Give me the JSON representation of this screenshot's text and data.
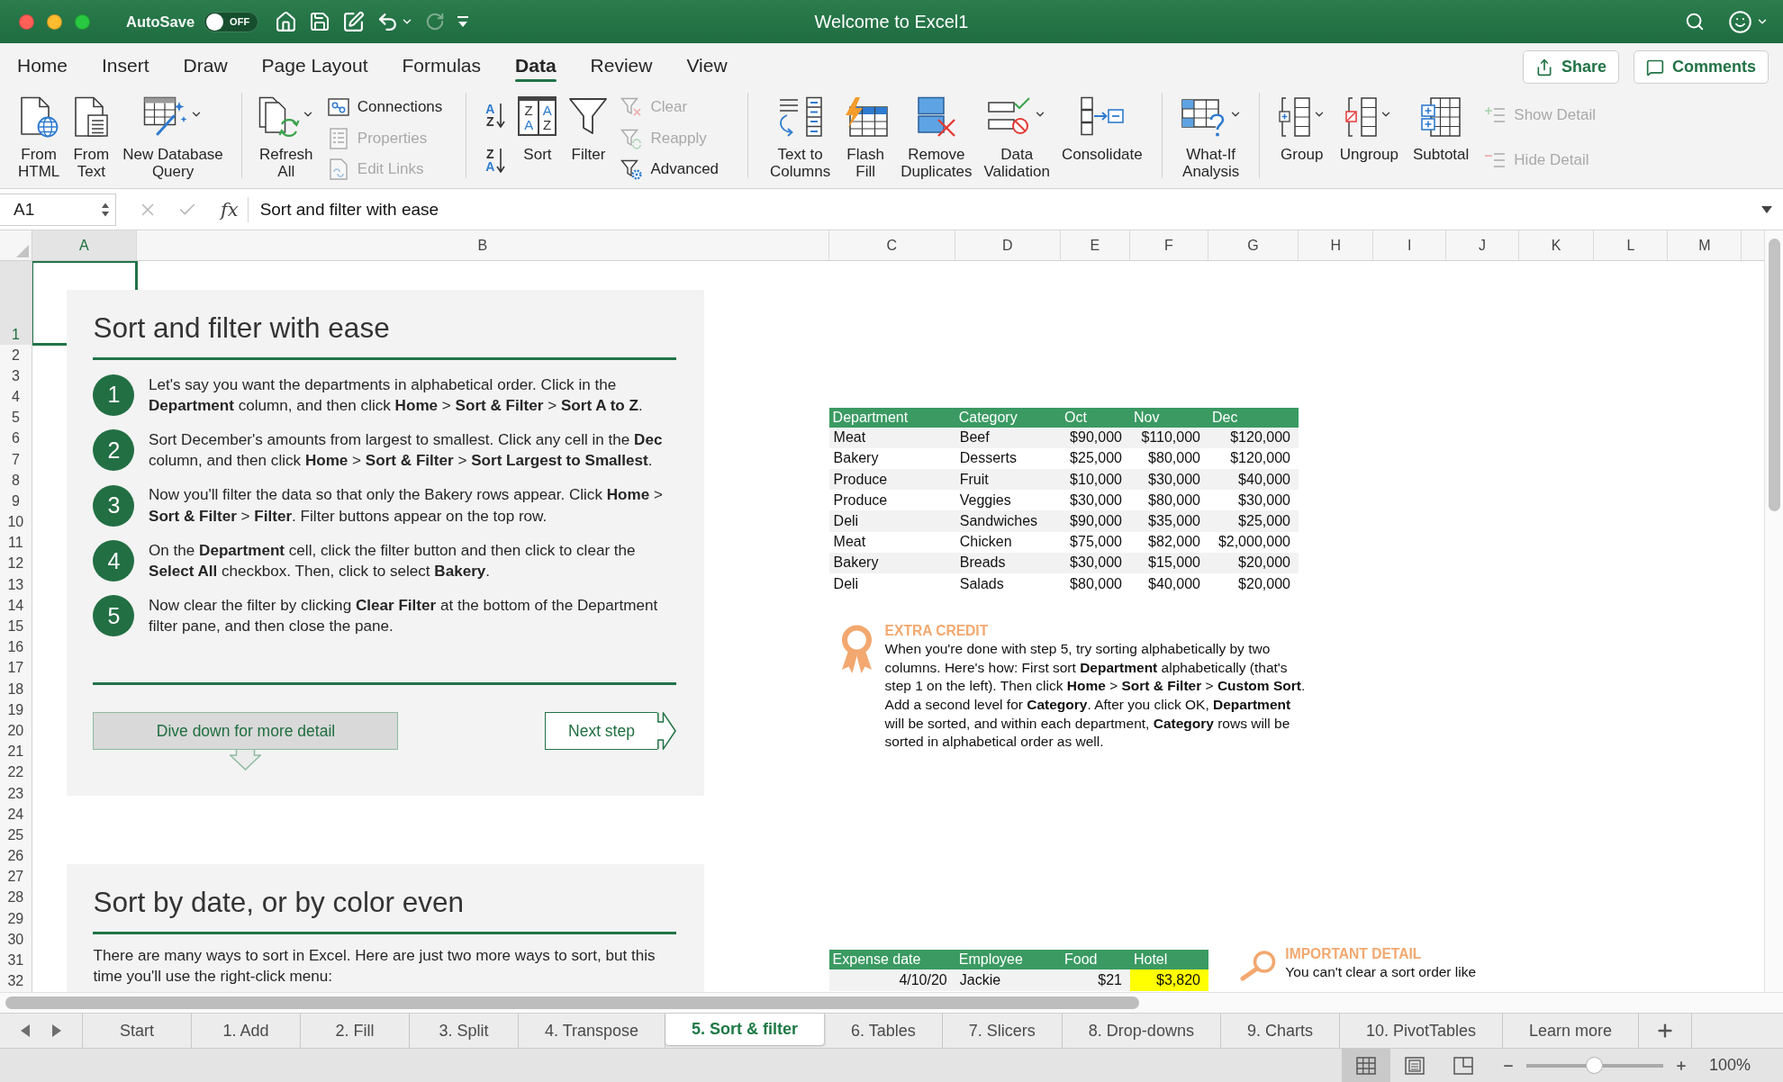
{
  "window": {
    "title": "Welcome to Excel1"
  },
  "title_bar": {
    "autosave": {
      "label": "AutoSave",
      "on": false,
      "state_text": "OFF"
    },
    "quick_access": [
      {
        "disabled": false
      },
      {
        "disabled": false
      },
      {
        "disabled": false
      },
      {
        "disabled": false,
        "dropdown": true
      },
      {
        "disabled": true
      },
      {
        "disabled": false
      }
    ]
  },
  "ribbon_tabs": [
    {
      "label": "Home",
      "selected": false
    },
    {
      "label": "Insert",
      "selected": false
    },
    {
      "label": "Draw",
      "selected": false
    },
    {
      "label": "Page Layout",
      "selected": false
    },
    {
      "label": "Formulas",
      "selected": false
    },
    {
      "label": "Data",
      "selected": true
    },
    {
      "label": "Review",
      "selected": false
    },
    {
      "label": "View",
      "selected": false
    }
  ],
  "header_buttons": [
    {
      "label": "Share"
    },
    {
      "label": "Comments"
    }
  ],
  "ribbon": {
    "groups": [
      {
        "items": [
          {
            "kind": "large",
            "lines": [
              "From",
              "HTML"
            ],
            "dropdown": false
          },
          {
            "kind": "large",
            "lines": [
              "From",
              "Text"
            ],
            "dropdown": false
          },
          {
            "kind": "large",
            "lines": [
              "New Database",
              "Query"
            ],
            "dropdown": true
          }
        ]
      },
      {
        "items": [
          {
            "kind": "large",
            "lines": [
              "Refresh",
              "All"
            ],
            "dropdown": true
          },
          {
            "kind": "stack",
            "entries": [
              {
                "label": "Connections",
                "disabled": false
              },
              {
                "label": "Properties",
                "disabled": true
              },
              {
                "label": "Edit Links",
                "disabled": true
              }
            ]
          }
        ]
      },
      {
        "items": [
          {
            "kind": "sort_pair",
            "entries": [
              {
                "glyphs": [
                  "A",
                  "Z"
                ]
              },
              {
                "glyphs": [
                  "Z",
                  "A"
                ]
              }
            ]
          },
          {
            "kind": "sort",
            "lines": [
              "Sort"
            ],
            "glyphs": [
              "Z",
              "A",
              "A",
              "Z"
            ]
          },
          {
            "kind": "large",
            "lines": [
              "Filter"
            ],
            "dropdown": false
          },
          {
            "kind": "stack",
            "entries": [
              {
                "label": "Clear",
                "disabled": true
              },
              {
                "label": "Reapply",
                "disabled": true
              },
              {
                "label": "Advanced",
                "disabled": false
              }
            ]
          }
        ]
      },
      {
        "items": [
          {
            "kind": "large",
            "lines": [
              "Text to",
              "Columns"
            ],
            "dropdown": false
          },
          {
            "kind": "large",
            "lines": [
              "Flash",
              "Fill"
            ],
            "dropdown": false
          },
          {
            "kind": "large",
            "lines": [
              "Remove",
              "Duplicates"
            ],
            "dropdown": false
          },
          {
            "kind": "large",
            "lines": [
              "Data",
              "Validation"
            ],
            "dropdown": true
          },
          {
            "kind": "large",
            "lines": [
              "Consolidate"
            ],
            "dropdown": false
          }
        ]
      },
      {
        "items": [
          {
            "kind": "large",
            "lines": [
              "What-If",
              "Analysis"
            ],
            "dropdown": true
          }
        ]
      },
      {
        "items": [
          {
            "kind": "large",
            "lines": [
              "Group"
            ],
            "dropdown": true
          },
          {
            "kind": "large",
            "lines": [
              "Ungroup"
            ],
            "dropdown": true
          },
          {
            "kind": "large",
            "lines": [
              "Subtotal"
            ],
            "dropdown": false
          },
          {
            "kind": "stack",
            "entries": [
              {
                "label": "Show Detail",
                "disabled": true
              },
              {
                "label": "Hide Detail",
                "disabled": true
              }
            ]
          }
        ]
      }
    ]
  },
  "formula_bar": {
    "name_box": "A1",
    "function_label": "fx",
    "formula": "Sort and filter with ease"
  },
  "columns": [
    {
      "label": "A",
      "selected": true
    },
    {
      "label": "B",
      "selected": false
    },
    {
      "label": "C",
      "selected": false
    },
    {
      "label": "D",
      "selected": false
    },
    {
      "label": "E",
      "selected": false
    },
    {
      "label": "F",
      "selected": false
    },
    {
      "label": "G",
      "selected": false
    },
    {
      "label": "H",
      "selected": false
    },
    {
      "label": "I",
      "selected": false
    },
    {
      "label": "J",
      "selected": false
    },
    {
      "label": "K",
      "selected": false
    },
    {
      "label": "L",
      "selected": false
    },
    {
      "label": "M",
      "selected": false
    }
  ],
  "rows": [
    {
      "label": "1",
      "selected": true
    },
    {
      "label": "2",
      "selected": false
    },
    {
      "label": "3",
      "selected": false
    },
    {
      "label": "4",
      "selected": false
    },
    {
      "label": "5",
      "selected": false
    },
    {
      "label": "6",
      "selected": false
    },
    {
      "label": "7",
      "selected": false
    },
    {
      "label": "8",
      "selected": false
    },
    {
      "label": "9",
      "selected": false
    },
    {
      "label": "10",
      "selected": false
    },
    {
      "label": "11",
      "selected": false
    },
    {
      "label": "12",
      "selected": false
    },
    {
      "label": "13",
      "selected": false
    },
    {
      "label": "14",
      "selected": false
    },
    {
      "label": "15",
      "selected": false
    },
    {
      "label": "16",
      "selected": false
    },
    {
      "label": "17",
      "selected": false
    },
    {
      "label": "18",
      "selected": false
    },
    {
      "label": "19",
      "selected": false
    },
    {
      "label": "20",
      "selected": false
    },
    {
      "label": "21",
      "selected": false
    },
    {
      "label": "22",
      "selected": false
    },
    {
      "label": "23",
      "selected": false
    },
    {
      "label": "24",
      "selected": false
    },
    {
      "label": "25",
      "selected": false
    },
    {
      "label": "26",
      "selected": false
    },
    {
      "label": "27",
      "selected": false
    },
    {
      "label": "28",
      "selected": false
    },
    {
      "label": "29",
      "selected": false
    },
    {
      "label": "30",
      "selected": false
    },
    {
      "label": "31",
      "selected": false
    },
    {
      "label": "32",
      "selected": false
    }
  ],
  "lesson_panels": [
    {
      "title": "Sort and filter with ease",
      "steps": [
        {
          "number": "1",
          "text": "Let's say you want the departments in alphabetical order. Click in the **Department** column, and then click **Home** > **Sort & Filter** > **Sort A to Z**."
        },
        {
          "number": "2",
          "text": "Sort December's amounts from largest to smallest. Click any cell in the **Dec** column, and then click **Home** > **Sort & Filter** > **Sort Largest to Smallest**."
        },
        {
          "number": "3",
          "text": "Now you'll filter the data so that only the Bakery rows appear. Click **Home** > **Sort & Filter** > **Filter**. Filter buttons appear on the top row."
        },
        {
          "number": "4",
          "text": "On the **Department** cell, click the filter button and then click to clear the **Select All** checkbox. Then, click to select **Bakery**."
        },
        {
          "number": "5",
          "text": "Now clear the filter by clicking **Clear Filter** at the bottom of the Department filter pane, and then close the pane."
        }
      ],
      "buttons": [
        {
          "kind": "dive",
          "label": "Dive down for more detail"
        },
        {
          "kind": "next",
          "label": "Next step"
        }
      ]
    },
    {
      "title": "Sort by date, or by color even",
      "text": "There are many ways to sort in Excel. Here are just two more ways to sort, but this time you'll use the right-click menu:"
    }
  ],
  "sales_table": {
    "columns": [
      "Department",
      "Category",
      "Oct",
      "Nov",
      "Dec"
    ],
    "rows": [
      [
        "Meat",
        "Beef",
        "$90,000",
        "$110,000",
        "$120,000"
      ],
      [
        "Bakery",
        "Desserts",
        "$25,000",
        "$80,000",
        "$120,000"
      ],
      [
        "Produce",
        "Fruit",
        "$10,000",
        "$30,000",
        "$40,000"
      ],
      [
        "Produce",
        "Veggies",
        "$30,000",
        "$80,000",
        "$30,000"
      ],
      [
        "Deli",
        "Sandwiches",
        "$90,000",
        "$35,000",
        "$25,000"
      ],
      [
        "Meat",
        "Chicken",
        "$75,000",
        "$82,000",
        "$2,000,000"
      ],
      [
        "Bakery",
        "Breads",
        "$30,000",
        "$15,000",
        "$20,000"
      ],
      [
        "Deli",
        "Salads",
        "$80,000",
        "$40,000",
        "$20,000"
      ]
    ]
  },
  "extra_credit": {
    "title": "EXTRA CREDIT",
    "text": "When you're done with step 5, try sorting alphabetically by two columns. Here's how: First sort **Department** alphabetically (that's step 1 on the left). Then click **Home** > **Sort & Filter** > **Custom Sort**. Add a second level for **Category**. After you click OK, **Department** will be sorted, and within each department, **Category** rows will be sorted in alphabetical order as well."
  },
  "expense_table": {
    "columns": [
      "Expense date",
      "Employee",
      "Food",
      "Hotel"
    ],
    "rows": [
      [
        {
          "text": "4/10/20",
          "highlighted": false
        },
        {
          "text": "Jackie",
          "highlighted": false
        },
        {
          "text": "$21",
          "highlighted": false
        },
        {
          "text": "$3,820",
          "highlighted": true
        }
      ]
    ]
  },
  "important_detail": {
    "title": "IMPORTANT DETAIL",
    "text": "You can't clear a sort order like"
  },
  "sheet_tabs": [
    {
      "label": "Start",
      "selected": false
    },
    {
      "label": "1. Add",
      "selected": false
    },
    {
      "label": "2. Fill",
      "selected": false
    },
    {
      "label": "3. Split",
      "selected": false
    },
    {
      "label": "4. Transpose",
      "selected": false
    },
    {
      "label": "5. Sort & filter",
      "selected": true
    },
    {
      "label": "6. Tables",
      "selected": false
    },
    {
      "label": "7. Slicers",
      "selected": false
    },
    {
      "label": "8. Drop-downs",
      "selected": false
    },
    {
      "label": "9. Charts",
      "selected": false
    },
    {
      "label": "10. PivotTables",
      "selected": false
    },
    {
      "label": "Learn more",
      "selected": false
    }
  ],
  "status_bar": {
    "views": [
      {
        "selected": true
      },
      {
        "selected": false
      },
      {
        "selected": false
      }
    ],
    "zoom": {
      "level": 0.5,
      "text": "100%"
    }
  }
}
